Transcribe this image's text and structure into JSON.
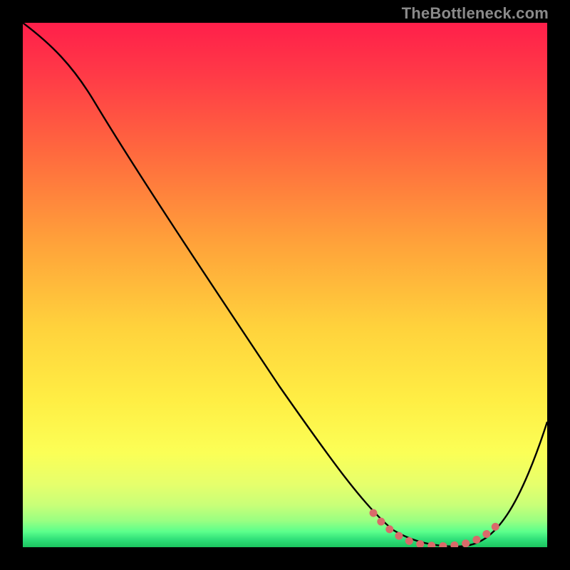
{
  "watermark": "TheBottleneck.com",
  "chart_data": {
    "type": "line",
    "title": "",
    "xlabel": "",
    "ylabel": "",
    "xlim": [
      0,
      100
    ],
    "ylim": [
      0,
      100
    ],
    "grid": false,
    "series": [
      {
        "name": "curve",
        "color": "#000000",
        "x": [
          0,
          4,
          8,
          12,
          16,
          20,
          25,
          30,
          35,
          40,
          45,
          50,
          55,
          60,
          62,
          64,
          66,
          68,
          70,
          72,
          74,
          76,
          78,
          80,
          82,
          84,
          86,
          88,
          90,
          92,
          94,
          96,
          98,
          100
        ],
        "y": [
          100,
          97,
          94,
          90,
          86,
          81,
          75,
          68,
          61,
          54,
          47,
          40,
          33,
          25,
          22,
          19,
          16,
          13,
          10,
          8,
          6,
          4,
          3,
          2,
          1,
          1,
          1,
          2,
          4,
          7,
          11,
          16,
          22,
          29
        ]
      },
      {
        "name": "bottleneck-trough",
        "color": "#d96a6a",
        "x": [
          68,
          71,
          74,
          77,
          80,
          83,
          86,
          89,
          91
        ],
        "y": [
          7,
          5,
          3,
          2,
          1,
          1,
          1,
          2,
          4
        ]
      }
    ],
    "background_gradient": {
      "top": "#ff1f4a",
      "mid": "#ffd23c",
      "bottom": "#1bc45f"
    }
  }
}
